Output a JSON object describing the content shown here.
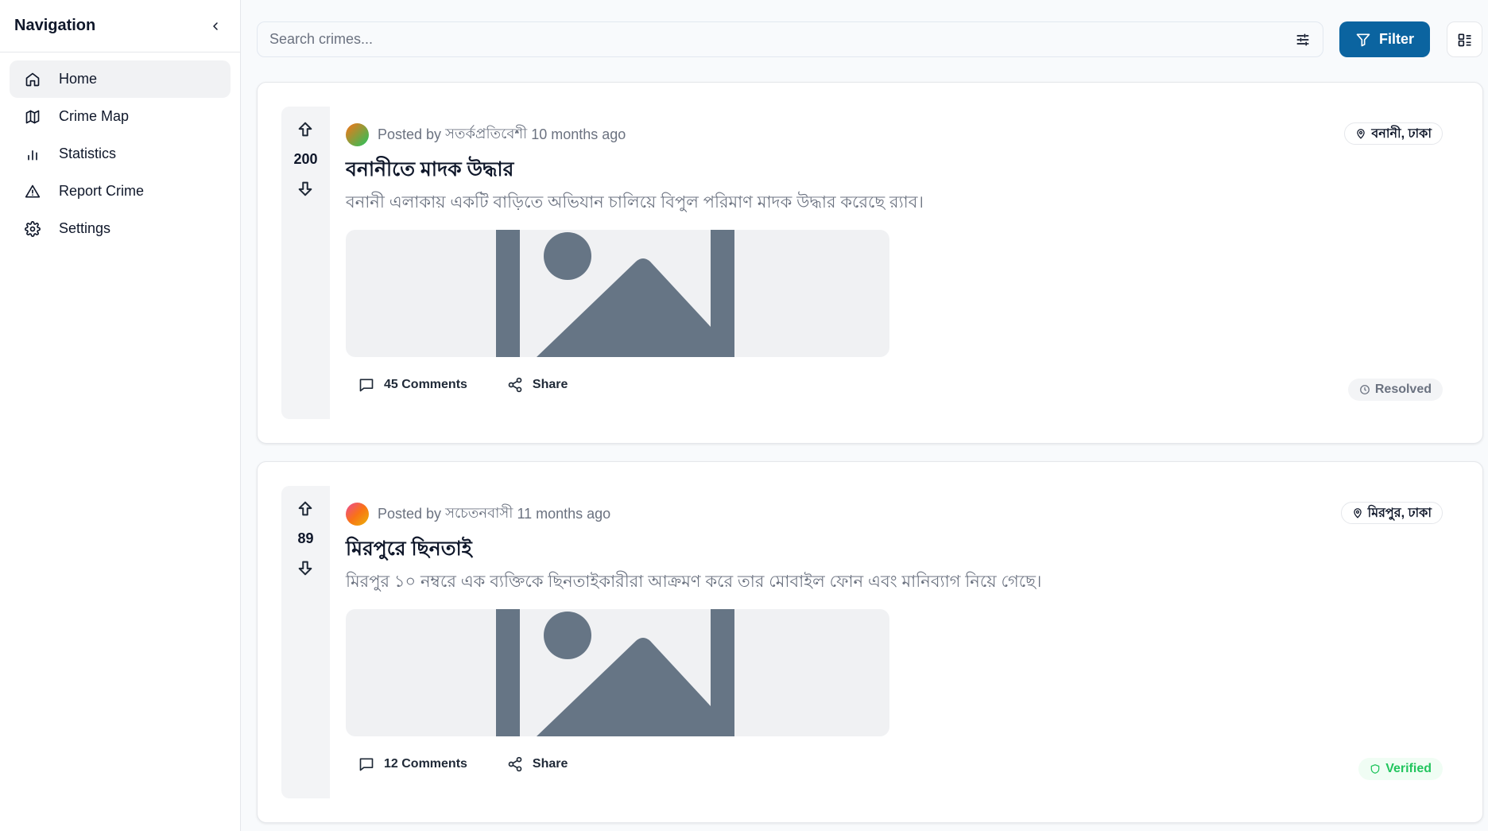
{
  "sidebar": {
    "title": "Navigation",
    "items": [
      {
        "label": "Home",
        "icon": "home-icon"
      },
      {
        "label": "Crime Map",
        "icon": "map-icon"
      },
      {
        "label": "Statistics",
        "icon": "bar-chart-icon"
      },
      {
        "label": "Report Crime",
        "icon": "alert-triangle-icon"
      },
      {
        "label": "Settings",
        "icon": "gear-icon"
      }
    ]
  },
  "search": {
    "placeholder": "Search crimes...",
    "value": ""
  },
  "toolbar": {
    "filter_label": "Filter"
  },
  "colors": {
    "accent": "#0b64a0",
    "verified": "#22c55e",
    "muted": "#6b7280"
  },
  "posts": [
    {
      "votes": "200",
      "posted_by_label": "Posted by",
      "author": "সতর্কপ্রতিবেশী",
      "time": "10 months ago",
      "title": "বনানীতে মাদক উদ্ধার",
      "body": "বনানী এলাকায় একটি বাড়িতে অভিযান চালিয়ে বিপুল পরিমাণ মাদক উদ্ধার করেছে র‍্যাব।",
      "location": "বনানী, ঢাকা",
      "comments": "45 Comments",
      "share": "Share",
      "status": "Resolved"
    },
    {
      "votes": "89",
      "posted_by_label": "Posted by",
      "author": "সচেতনবাসী",
      "time": "11 months ago",
      "title": "মিরপুরে ছিনতাই",
      "body": "মিরপুর ১০ নম্বরে এক ব্যক্তিকে ছিনতাইকারীরা আক্রমণ করে তার মোবাইল ফোন এবং মানিব্যাগ নিয়ে গেছে।",
      "location": "মিরপুর, ঢাকা",
      "comments": "12 Comments",
      "share": "Share",
      "status": "Verified"
    }
  ]
}
